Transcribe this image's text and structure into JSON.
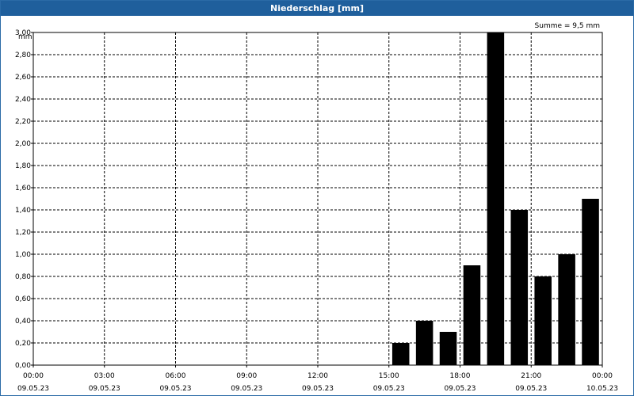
{
  "window": {
    "title": "Niederschlag [mm]"
  },
  "chart_data": {
    "type": "bar",
    "title": "Niederschlag [mm]",
    "annotation": "Summe = 9,5 mm",
    "ylabel": "mm",
    "xlabel": "",
    "ylim": [
      0,
      3.0
    ],
    "ytick_step": 0.2,
    "yticks": [
      "0,00",
      "0,20",
      "0,40",
      "0,60",
      "0,80",
      "1,00",
      "1,20",
      "1,40",
      "1,60",
      "1,80",
      "2,00",
      "2,20",
      "2,40",
      "2,60",
      "2,80",
      "3,00"
    ],
    "x_range_hours": [
      0,
      24
    ],
    "xticks": [
      {
        "time": "00:00",
        "date": "09.05.23"
      },
      {
        "time": "03:00",
        "date": "09.05.23"
      },
      {
        "time": "06:00",
        "date": "09.05.23"
      },
      {
        "time": "09:00",
        "date": "09.05.23"
      },
      {
        "time": "12:00",
        "date": "09.05.23"
      },
      {
        "time": "15:00",
        "date": "09.05.23"
      },
      {
        "time": "18:00",
        "date": "09.05.23"
      },
      {
        "time": "21:00",
        "date": "09.05.23"
      },
      {
        "time": "00:00",
        "date": "10.05.23"
      }
    ],
    "bars": [
      {
        "hour": 15,
        "value": 0.2
      },
      {
        "hour": 16,
        "value": 0.4
      },
      {
        "hour": 17,
        "value": 0.3
      },
      {
        "hour": 18,
        "value": 0.9
      },
      {
        "hour": 19,
        "value": 3.0
      },
      {
        "hour": 20,
        "value": 1.4
      },
      {
        "hour": 21,
        "value": 0.8
      },
      {
        "hour": 22,
        "value": 1.0
      },
      {
        "hour": 23,
        "value": 1.5
      }
    ],
    "grid": true,
    "bar_color": "#000000"
  }
}
